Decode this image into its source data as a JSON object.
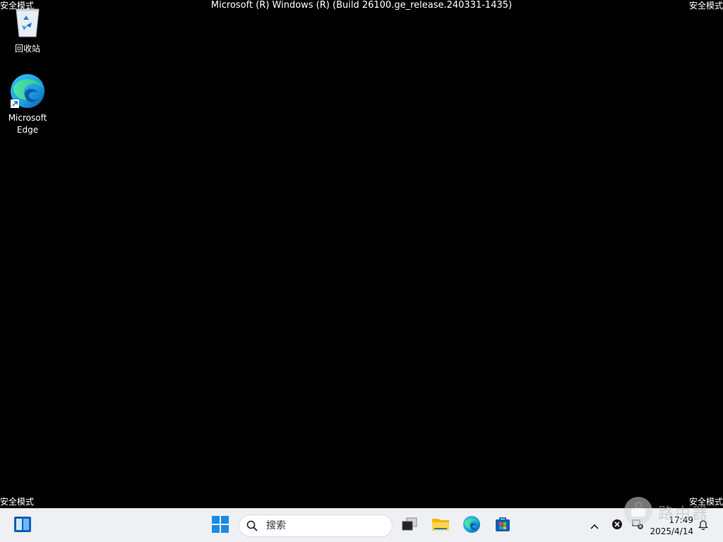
{
  "safe_mode_label": "安全模式",
  "build_title": "Microsoft (R) Windows (R) (Build 26100.ge_release.240331-1435)",
  "desktop": {
    "icons": [
      {
        "label": "回收站",
        "icon": "recycle-bin-icon"
      },
      {
        "label": "Microsoft\nEdge",
        "icon": "edge-icon"
      }
    ]
  },
  "taskbar": {
    "search_placeholder": "搜索",
    "apps": [
      "widgets-icon",
      "start-icon",
      "task-view-icon",
      "file-explorer-icon",
      "edge-icon",
      "store-icon"
    ],
    "clock": {
      "time": "17:49",
      "date": "2025/4/14"
    }
  },
  "watermark": "路由器",
  "colors": {
    "desktop_bg": "#000000",
    "taskbar_bg": "#eef0f4",
    "accent_blue": "#0078d4"
  }
}
